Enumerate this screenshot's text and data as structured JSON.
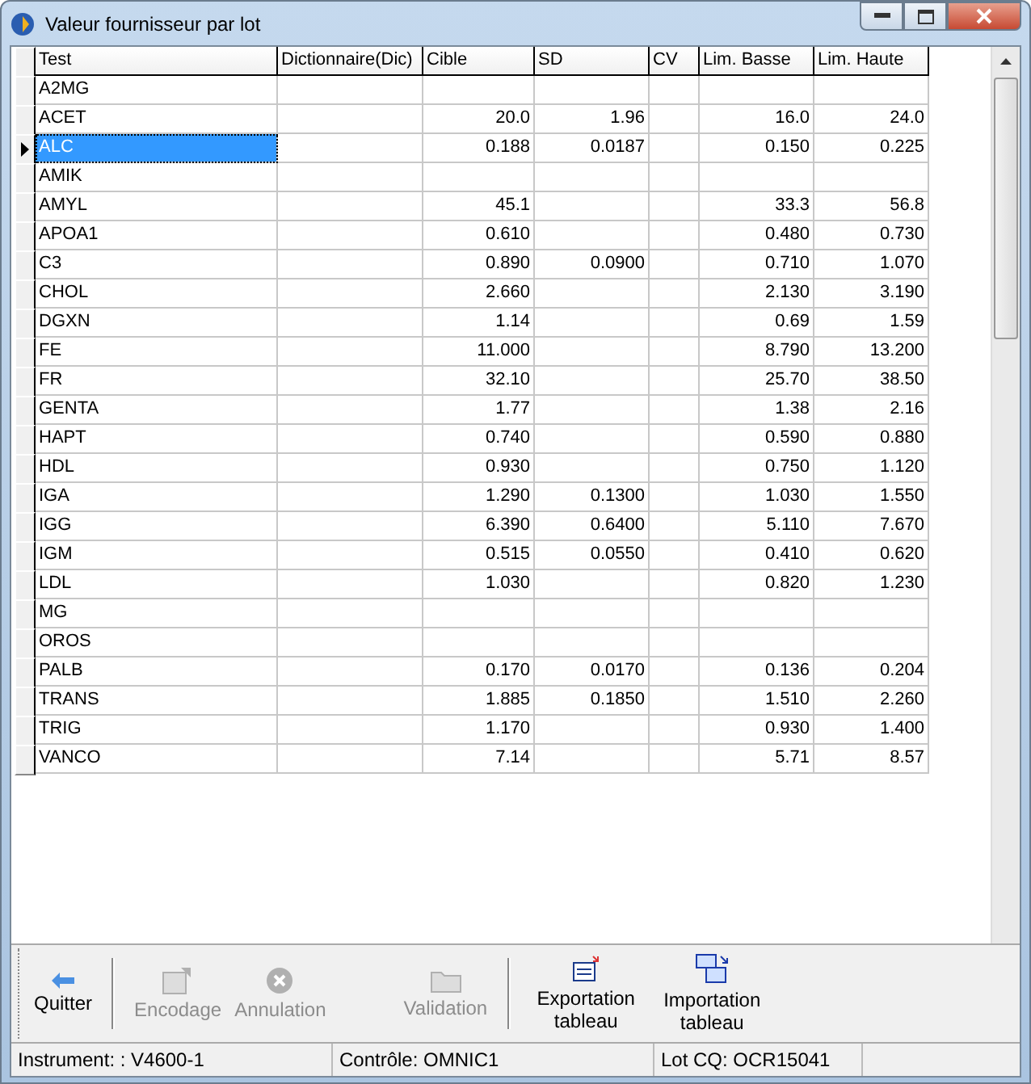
{
  "window": {
    "title": "Valeur fournisseur par lot"
  },
  "table": {
    "columns": [
      "Test",
      "Dictionnaire(Dic)",
      "Cible",
      "SD",
      "CV",
      "Lim. Basse",
      "Lim. Haute"
    ],
    "rows": [
      {
        "test": "A2MG",
        "selected": false
      },
      {
        "test": "ACET",
        "cible": "20.0",
        "sd": "1.96",
        "lim_basse": "16.0",
        "lim_haute": "24.0",
        "selected": false
      },
      {
        "test": "ALC",
        "cible": "0.188",
        "sd": "0.0187",
        "lim_basse": "0.150",
        "lim_haute": "0.225",
        "selected": true
      },
      {
        "test": "AMIK",
        "selected": false
      },
      {
        "test": "AMYL",
        "cible": "45.1",
        "lim_basse": "33.3",
        "lim_haute": "56.8",
        "selected": false
      },
      {
        "test": "APOA1",
        "cible": "0.610",
        "lim_basse": "0.480",
        "lim_haute": "0.730",
        "selected": false
      },
      {
        "test": "C3",
        "cible": "0.890",
        "sd": "0.0900",
        "lim_basse": "0.710",
        "lim_haute": "1.070",
        "selected": false
      },
      {
        "test": "CHOL",
        "cible": "2.660",
        "lim_basse": "2.130",
        "lim_haute": "3.190",
        "selected": false
      },
      {
        "test": "DGXN",
        "cible": "1.14",
        "lim_basse": "0.69",
        "lim_haute": "1.59",
        "selected": false
      },
      {
        "test": "FE",
        "cible": "11.000",
        "lim_basse": "8.790",
        "lim_haute": "13.200",
        "selected": false
      },
      {
        "test": "FR",
        "cible": "32.10",
        "lim_basse": "25.70",
        "lim_haute": "38.50",
        "selected": false
      },
      {
        "test": "GENTA",
        "cible": "1.77",
        "lim_basse": "1.38",
        "lim_haute": "2.16",
        "selected": false
      },
      {
        "test": "HAPT",
        "cible": "0.740",
        "lim_basse": "0.590",
        "lim_haute": "0.880",
        "selected": false
      },
      {
        "test": "HDL",
        "cible": "0.930",
        "lim_basse": "0.750",
        "lim_haute": "1.120",
        "selected": false
      },
      {
        "test": "IGA",
        "cible": "1.290",
        "sd": "0.1300",
        "lim_basse": "1.030",
        "lim_haute": "1.550",
        "selected": false
      },
      {
        "test": "IGG",
        "cible": "6.390",
        "sd": "0.6400",
        "lim_basse": "5.110",
        "lim_haute": "7.670",
        "selected": false
      },
      {
        "test": "IGM",
        "cible": "0.515",
        "sd": "0.0550",
        "lim_basse": "0.410",
        "lim_haute": "0.620",
        "selected": false
      },
      {
        "test": "LDL",
        "cible": "1.030",
        "lim_basse": "0.820",
        "lim_haute": "1.230",
        "selected": false
      },
      {
        "test": "MG",
        "selected": false
      },
      {
        "test": "OROS",
        "selected": false
      },
      {
        "test": "PALB",
        "cible": "0.170",
        "sd": "0.0170",
        "lim_basse": "0.136",
        "lim_haute": "0.204",
        "selected": false
      },
      {
        "test": "TRANS",
        "cible": "1.885",
        "sd": "0.1850",
        "lim_basse": "1.510",
        "lim_haute": "2.260",
        "selected": false
      },
      {
        "test": "TRIG",
        "cible": "1.170",
        "lim_basse": "0.930",
        "lim_haute": "1.400",
        "selected": false
      },
      {
        "test": "VANCO",
        "cible": "7.14",
        "lim_basse": "5.71",
        "lim_haute": "8.57",
        "selected": false
      }
    ]
  },
  "toolbar": [
    {
      "kind": "quit",
      "label": "Quitter",
      "disabled": false
    },
    {
      "kind": "encode",
      "label": "Encodage",
      "disabled": true
    },
    {
      "kind": "cancel",
      "label": "Annulation",
      "disabled": true
    },
    {
      "kind": "validate",
      "label": "Validation",
      "disabled": true
    },
    {
      "kind": "export",
      "label": "Exportation tableau",
      "disabled": false
    },
    {
      "kind": "import",
      "label": "Importation tableau",
      "disabled": false
    }
  ],
  "status_bar": [
    "Instrument: : V4600-1",
    "Contrôle: OMNIC1",
    "Lot CQ: OCR15041"
  ]
}
